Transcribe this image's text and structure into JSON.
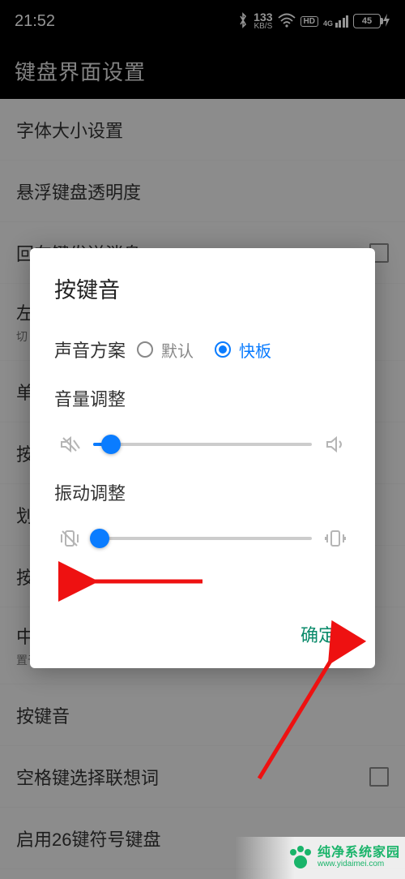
{
  "status": {
    "time": "21:52",
    "net_speed": "133",
    "net_unit": "KB/S",
    "hd_badge": "HD",
    "signal_label": "4G",
    "battery_pct": "45"
  },
  "header": {
    "title": "键盘界面设置"
  },
  "rows": {
    "font_size": "字体大小设置",
    "float_opacity": "悬浮键盘透明度",
    "enter_send": "回车键发送消息",
    "left_something": "左",
    "single": "单",
    "press_1": "按",
    "strike": "划",
    "press_2": "按",
    "center_line": "中",
    "center_sub": "置于面板顶部",
    "key_sound": "按键音",
    "space_cand": "空格键选择联想词",
    "enable_26": "启用26键符号键盘"
  },
  "dialog": {
    "title": "按键音",
    "scheme_label": "声音方案",
    "opt_default": "默认",
    "opt_clapper": "快板",
    "volume_label": "音量调整",
    "volume_value": 8,
    "vibrate_label": "振动调整",
    "vibrate_value": 3,
    "ok": "确定"
  },
  "watermark": {
    "brand": "纯净系统家园",
    "url": "www.yidaimei.com"
  },
  "icons": {
    "bluetooth": "bluetooth-icon",
    "wifi": "wifi-icon",
    "signal": "signal-icon",
    "mute": "mute-icon",
    "speaker": "speaker-icon",
    "vibrate_off": "vibrate-off-icon",
    "vibrate_on": "vibrate-on-icon",
    "charge": "charge-icon"
  },
  "colors": {
    "accent": "#0a7cff",
    "confirm": "#0a8a6a",
    "wm": "#19b46a",
    "arrow": "#e11"
  }
}
